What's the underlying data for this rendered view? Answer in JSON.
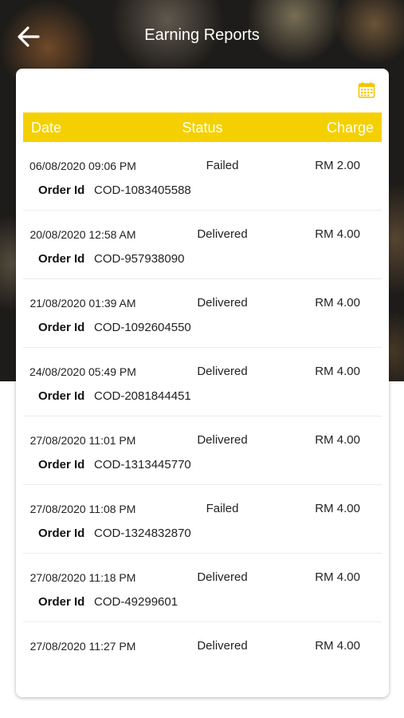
{
  "header": {
    "title": "Earning Reports"
  },
  "table": {
    "columns": {
      "date": "Date",
      "status": "Status",
      "charge": "Charge"
    },
    "order_label": "Order Id",
    "rows": [
      {
        "date": "06/08/2020 09:06 PM",
        "status": "Failed",
        "charge": "RM 2.00",
        "order_id": "COD-1083405588"
      },
      {
        "date": "20/08/2020 12:58 AM",
        "status": "Delivered",
        "charge": "RM 4.00",
        "order_id": "COD-957938090"
      },
      {
        "date": "21/08/2020 01:39 AM",
        "status": "Delivered",
        "charge": "RM 4.00",
        "order_id": "COD-1092604550"
      },
      {
        "date": "24/08/2020 05:49 PM",
        "status": "Delivered",
        "charge": "RM 4.00",
        "order_id": "COD-2081844451"
      },
      {
        "date": "27/08/2020 11:01 PM",
        "status": "Delivered",
        "charge": "RM 4.00",
        "order_id": "COD-1313445770"
      },
      {
        "date": "27/08/2020 11:08 PM",
        "status": "Failed",
        "charge": "RM 4.00",
        "order_id": "COD-1324832870"
      },
      {
        "date": "27/08/2020 11:18 PM",
        "status": "Delivered",
        "charge": "RM 4.00",
        "order_id": "COD-49299601"
      },
      {
        "date": "27/08/2020 11:27 PM",
        "status": "Delivered",
        "charge": "RM 4.00",
        "order_id": ""
      }
    ]
  },
  "icons": {
    "back": "arrow-left-icon",
    "calendar": "calendar-icon"
  },
  "colors": {
    "accent": "#f5d000",
    "header_bg": "#1e1c1a"
  }
}
